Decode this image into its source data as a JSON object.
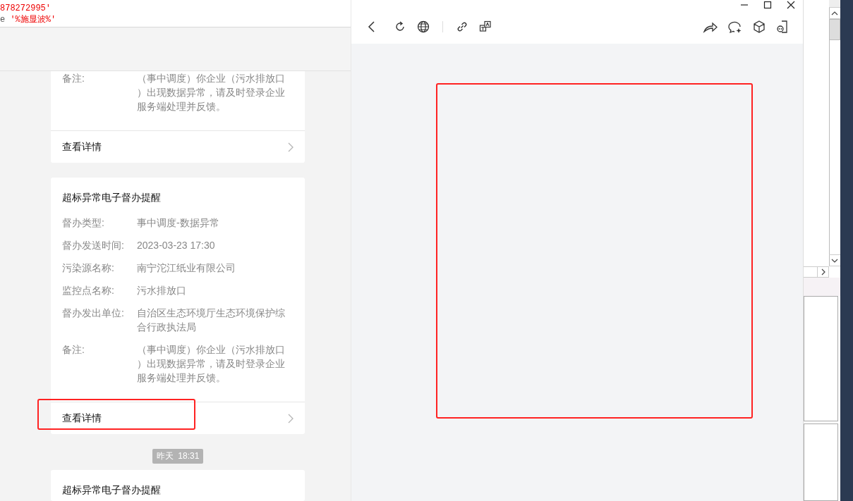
{
  "code_lines": [
    {
      "text": "878272995'"
    },
    {
      "prefix": "e ",
      "text": "'%施显波%'"
    }
  ],
  "feed": [
    {
      "kind": "card",
      "fields": [
        {
          "label": "备注:",
          "value": "（事中调度）你企业（污水排放口）出现数据异常，请及时登录企业服务端处理并反馈。"
        }
      ],
      "link": "查看详情",
      "highlighted": false,
      "cut_top": true
    },
    {
      "kind": "card",
      "title": "超标异常电子督办提醒",
      "fields": [
        {
          "label": "督办类型:",
          "value": "事中调度-数据异常"
        },
        {
          "label": "督办发送时间:",
          "value": "2023-03-23 17:30"
        },
        {
          "label": "污染源名称:",
          "value": "南宁沱江纸业有限公司"
        },
        {
          "label": "监控点名称:",
          "value": "污水排放口"
        },
        {
          "label": "督办发出单位:",
          "value": "自治区生态环境厅生态环境保护综合行政执法局"
        },
        {
          "label": "备注:",
          "value": "（事中调度）你企业（污水排放口）出现数据异常，请及时登录企业服务端处理并反馈。"
        }
      ],
      "link": "查看详情",
      "highlighted": true,
      "cut_top": false
    },
    {
      "kind": "time",
      "text": "昨天  18:31"
    },
    {
      "kind": "card",
      "title": "超标异常电子督办提醒",
      "highlighted": false,
      "cut_top": false
    }
  ],
  "browser": {
    "annotation_frame": true
  }
}
